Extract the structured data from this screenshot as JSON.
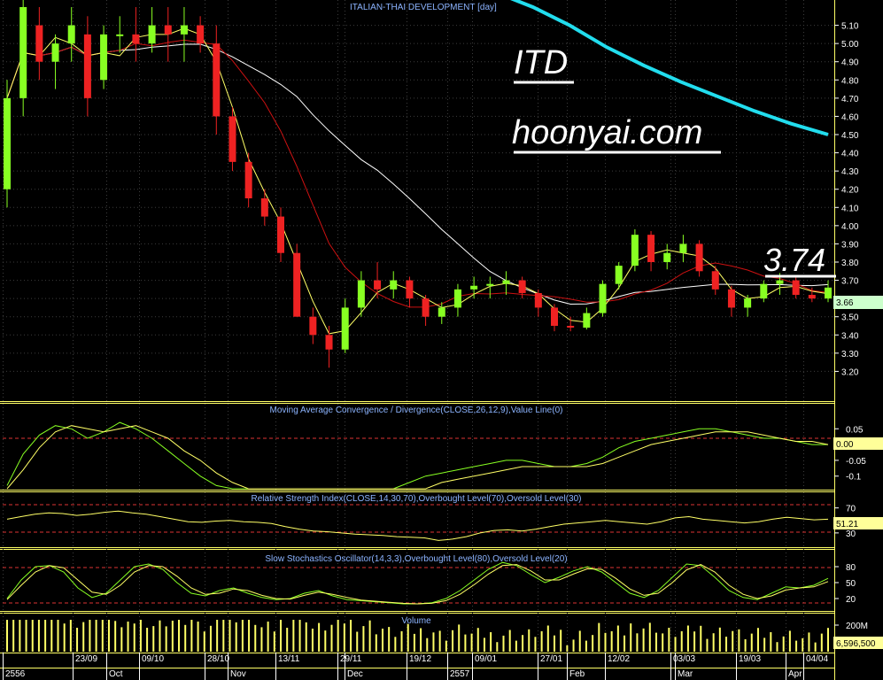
{
  "colors": {
    "background": "#000000",
    "panel_border": "#ffff66",
    "grid": "#3c3c3c",
    "label_blue": "#8cb4ff",
    "axis_text": "#ffffff",
    "bull": "#88ff22",
    "bear": "#ee2222",
    "ma_fast": "#ffff66",
    "ma_mid": "#cc1111",
    "ma_slow": "#ffffff",
    "ma_long": "#22ddee",
    "ref_line": "#dd3333",
    "osc_fast": "#88ff22",
    "osc_slow": "#ffff66",
    "price_tag": "#ccffcc"
  },
  "texts": {
    "chart_title": "ITALIAN-THAI DEVELOPMENT [day]",
    "ticker": "ITD",
    "site": "hoonyai.com",
    "price_note": "3.74",
    "last_price": "3.66",
    "macd_title": "Moving Average Convergence / Divergence(CLOSE,26,12,9),Value Line(0)",
    "macd_value": "0.00",
    "rsi_title": "Relative Strength Index(CLOSE,14,30,70),Overbought Level(70),Oversold Level(30)",
    "rsi_value": "51.21",
    "stoch_title": "Slow Stochastics Oscillator(14,3,3),Overbought Level(80),Oversold Level(20)",
    "volume_title": "Volume",
    "volume_value": "6,596,500"
  },
  "chart_data": [
    {
      "type": "candlestick",
      "title": "ITALIAN-THAI DEVELOPMENT [day]",
      "y_ticks": [
        "5.10",
        "5.00",
        "4.90",
        "4.80",
        "4.70",
        "4.60",
        "4.50",
        "4.40",
        "4.30",
        "4.20",
        "4.10",
        "4.00",
        "3.90",
        "3.80",
        "3.70",
        "3.60",
        "3.50",
        "3.40",
        "3.30",
        "3.20"
      ],
      "ylim": [
        3.1,
        5.2
      ],
      "last_price": 3.66,
      "ohlc": [
        [
          4.2,
          4.8,
          4.1,
          4.7
        ],
        [
          4.7,
          5.3,
          4.6,
          5.2
        ],
        [
          5.1,
          5.2,
          4.8,
          4.9
        ],
        [
          4.9,
          5.05,
          4.75,
          5.0
        ],
        [
          5.0,
          5.2,
          4.9,
          5.1
        ],
        [
          5.05,
          5.15,
          4.6,
          4.7
        ],
        [
          4.8,
          5.1,
          4.75,
          5.05
        ],
        [
          5.05,
          5.15,
          4.95,
          5.05
        ],
        [
          5.05,
          5.2,
          4.9,
          5.0
        ],
        [
          5.0,
          5.2,
          4.95,
          5.1
        ],
        [
          5.1,
          5.2,
          4.9,
          5.05
        ],
        [
          5.05,
          5.2,
          4.9,
          5.1
        ],
        [
          5.1,
          5.15,
          4.95,
          5.0
        ],
        [
          5.0,
          5.1,
          4.5,
          4.6
        ],
        [
          4.6,
          4.65,
          4.3,
          4.35
        ],
        [
          4.35,
          4.4,
          4.1,
          4.15
        ],
        [
          4.15,
          4.2,
          4.0,
          4.05
        ],
        [
          4.05,
          4.1,
          3.8,
          3.85
        ],
        [
          3.85,
          3.9,
          3.55,
          3.5
        ],
        [
          3.5,
          3.55,
          3.35,
          3.4
        ],
        [
          3.4,
          3.45,
          3.22,
          3.32
        ],
        [
          3.32,
          3.6,
          3.3,
          3.55
        ],
        [
          3.55,
          3.75,
          3.5,
          3.7
        ],
        [
          3.7,
          3.8,
          3.6,
          3.65
        ],
        [
          3.65,
          3.75,
          3.6,
          3.7
        ],
        [
          3.7,
          3.72,
          3.55,
          3.6
        ],
        [
          3.6,
          3.62,
          3.45,
          3.5
        ],
        [
          3.5,
          3.58,
          3.46,
          3.55
        ],
        [
          3.55,
          3.68,
          3.5,
          3.65
        ],
        [
          3.65,
          3.72,
          3.6,
          3.67
        ],
        [
          3.67,
          3.72,
          3.6,
          3.68
        ],
        [
          3.68,
          3.75,
          3.62,
          3.7
        ],
        [
          3.7,
          3.72,
          3.6,
          3.63
        ],
        [
          3.63,
          3.65,
          3.5,
          3.55
        ],
        [
          3.55,
          3.57,
          3.42,
          3.45
        ],
        [
          3.45,
          3.5,
          3.42,
          3.44
        ],
        [
          3.44,
          3.55,
          3.43,
          3.52
        ],
        [
          3.52,
          3.7,
          3.5,
          3.68
        ],
        [
          3.68,
          3.8,
          3.65,
          3.78
        ],
        [
          3.78,
          3.98,
          3.75,
          3.95
        ],
        [
          3.95,
          3.97,
          3.75,
          3.8
        ],
        [
          3.8,
          3.9,
          3.76,
          3.85
        ],
        [
          3.85,
          3.95,
          3.8,
          3.9
        ],
        [
          3.9,
          3.92,
          3.72,
          3.75
        ],
        [
          3.75,
          3.78,
          3.62,
          3.65
        ],
        [
          3.65,
          3.67,
          3.5,
          3.55
        ],
        [
          3.55,
          3.62,
          3.5,
          3.6
        ],
        [
          3.6,
          3.7,
          3.58,
          3.68
        ],
        [
          3.68,
          3.74,
          3.62,
          3.7
        ],
        [
          3.7,
          3.72,
          3.6,
          3.62
        ],
        [
          3.62,
          3.66,
          3.58,
          3.6
        ],
        [
          3.6,
          3.7,
          3.58,
          3.66
        ]
      ],
      "x_tick_labels": [
        "2556",
        "23/09",
        "Oct",
        "09/10",
        "28/10",
        "Nov",
        "13/11",
        "29/11",
        "Dec",
        "19/12",
        "2557",
        "09/01",
        "27/01",
        "Feb",
        "12/02",
        "03/03",
        "Mar",
        "19/03",
        "Apr",
        "04/04"
      ]
    },
    {
      "type": "line",
      "title": "Moving Average Convergence / Divergence(CLOSE,26,12,9),Value Line(0)",
      "y_ticks": [
        "0.05",
        "0.0",
        "-0.05",
        "-0.1"
      ],
      "ylim": [
        -0.14,
        0.09
      ],
      "series": [
        {
          "values": [
            -0.13,
            -0.03,
            0.03,
            0.06,
            0.05,
            0.02,
            0.04,
            0.07,
            0.05,
            0.02,
            -0.02,
            -0.06,
            -0.1,
            -0.13,
            -0.15,
            -0.18,
            -0.2,
            -0.22,
            -0.24,
            -0.25,
            -0.24,
            -0.22,
            -0.2,
            -0.17,
            -0.14,
            -0.12,
            -0.1,
            -0.09,
            -0.08,
            -0.07,
            -0.06,
            -0.05,
            -0.05,
            -0.06,
            -0.07,
            -0.07,
            -0.06,
            -0.04,
            -0.01,
            0.01,
            0.02,
            0.03,
            0.04,
            0.05,
            0.05,
            0.04,
            0.03,
            0.02,
            0.02,
            0.01,
            0.0,
            0.0
          ]
        },
        {
          "values": [
            -0.15,
            -0.08,
            -0.01,
            0.04,
            0.06,
            0.05,
            0.04,
            0.05,
            0.06,
            0.04,
            0.02,
            -0.02,
            -0.05,
            -0.09,
            -0.12,
            -0.15,
            -0.17,
            -0.19,
            -0.21,
            -0.23,
            -0.24,
            -0.24,
            -0.23,
            -0.21,
            -0.19,
            -0.16,
            -0.14,
            -0.12,
            -0.11,
            -0.1,
            -0.09,
            -0.08,
            -0.07,
            -0.07,
            -0.07,
            -0.07,
            -0.07,
            -0.06,
            -0.04,
            -0.02,
            0.0,
            0.01,
            0.02,
            0.03,
            0.04,
            0.04,
            0.04,
            0.03,
            0.02,
            0.01,
            0.01,
            0.0
          ]
        }
      ]
    },
    {
      "type": "line",
      "title": "Relative Strength Index(CLOSE,14,30,70),Overbought Level(70),Oversold Level(30)",
      "y_ticks": [
        "70",
        "50",
        "30"
      ],
      "ylim": [
        10,
        95
      ],
      "levels": [
        70,
        30
      ],
      "last_value": 51.21,
      "series": [
        {
          "values": [
            52,
            56,
            60,
            62,
            61,
            58,
            60,
            63,
            65,
            62,
            60,
            56,
            52,
            48,
            47,
            49,
            50,
            48,
            47,
            45,
            40,
            36,
            33,
            32,
            30,
            28,
            27,
            26,
            24,
            23,
            22,
            18,
            20,
            24,
            30,
            34,
            35,
            33,
            36,
            40,
            44,
            46,
            48,
            50,
            48,
            46,
            44,
            48,
            54,
            56,
            52,
            50,
            48,
            46,
            48,
            52,
            55,
            53,
            51,
            52
          ]
        }
      ]
    },
    {
      "type": "line",
      "title": "Slow Stochastics Oscillator(14,3,3),Overbought Level(80),Oversold Level(20)",
      "y_ticks": [
        "80",
        "50",
        "20"
      ],
      "ylim": [
        0,
        105
      ],
      "levels": [
        80,
        20
      ],
      "series": [
        {
          "values": [
            20,
            55,
            80,
            82,
            70,
            40,
            22,
            30,
            55,
            80,
            85,
            75,
            50,
            30,
            25,
            35,
            40,
            30,
            22,
            18,
            20,
            30,
            35,
            25,
            18,
            16,
            14,
            12,
            10,
            10,
            12,
            20,
            35,
            55,
            75,
            88,
            82,
            65,
            50,
            60,
            72,
            80,
            70,
            50,
            30,
            22,
            35,
            60,
            85,
            82,
            60,
            35,
            22,
            18,
            30,
            42,
            40,
            45,
            58
          ]
        },
        {
          "values": [
            18,
            45,
            70,
            82,
            78,
            55,
            32,
            28,
            45,
            70,
            82,
            80,
            62,
            40,
            28,
            30,
            38,
            35,
            26,
            20,
            19,
            26,
            32,
            28,
            22,
            17,
            15,
            13,
            11,
            10,
            11,
            16,
            28,
            46,
            66,
            82,
            84,
            72,
            55,
            55,
            66,
            76,
            75,
            58,
            38,
            26,
            30,
            50,
            74,
            84,
            70,
            45,
            28,
            20,
            25,
            36,
            40,
            42,
            52
          ]
        }
      ]
    },
    {
      "type": "bar",
      "title": "Volume",
      "y_ticks": [
        "200M"
      ],
      "ylim": [
        0,
        280000000
      ],
      "last_value": 6596500
    }
  ]
}
